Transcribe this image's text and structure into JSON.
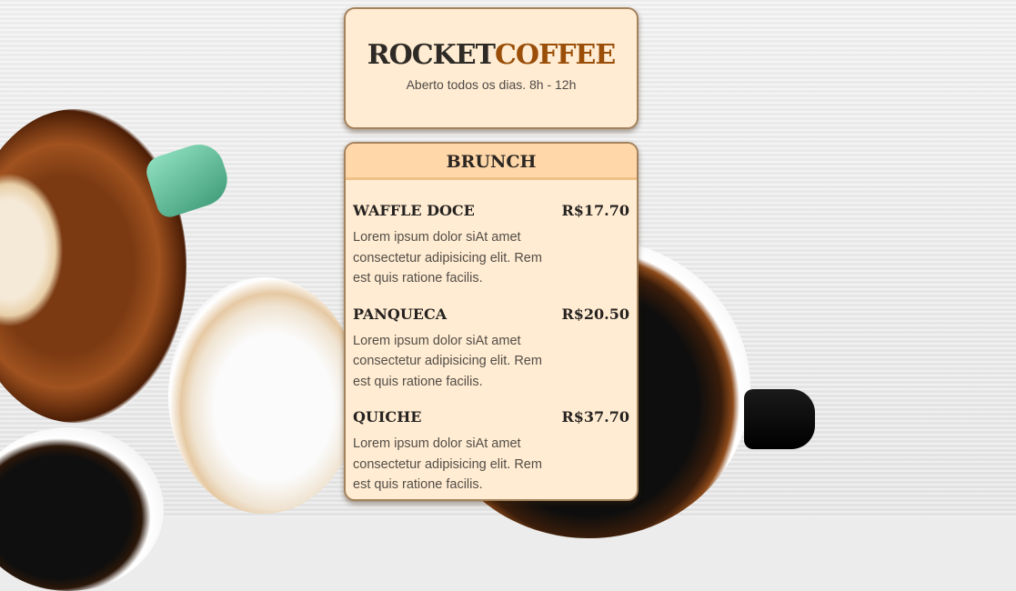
{
  "header": {
    "brand_part1": "ROCKET",
    "brand_part2": "COFFEE",
    "hours": "Aberto todos os dias. 8h - 12h"
  },
  "menu": {
    "title": "BRUNCH",
    "items": [
      {
        "name": "WAFFLE DOCE",
        "price": "R$17.70",
        "description": "Lorem ipsum dolor siAt amet consectetur adipisicing elit. Rem est quis ratione facilis."
      },
      {
        "name": "PANQUECA",
        "price": "R$20.50",
        "description": "Lorem ipsum dolor siAt amet consectetur adipisicing elit. Rem est quis ratione facilis."
      },
      {
        "name": "QUICHE",
        "price": "R$37.70",
        "description": "Lorem ipsum dolor siAt amet consectetur adipisicing elit. Rem est quis ratione facilis."
      }
    ]
  },
  "colors": {
    "card_background": "#ffecd2",
    "menu_title_background": "#ffd7a8",
    "brand_accent": "#9a4e08",
    "text_dark": "#2e2a26"
  }
}
